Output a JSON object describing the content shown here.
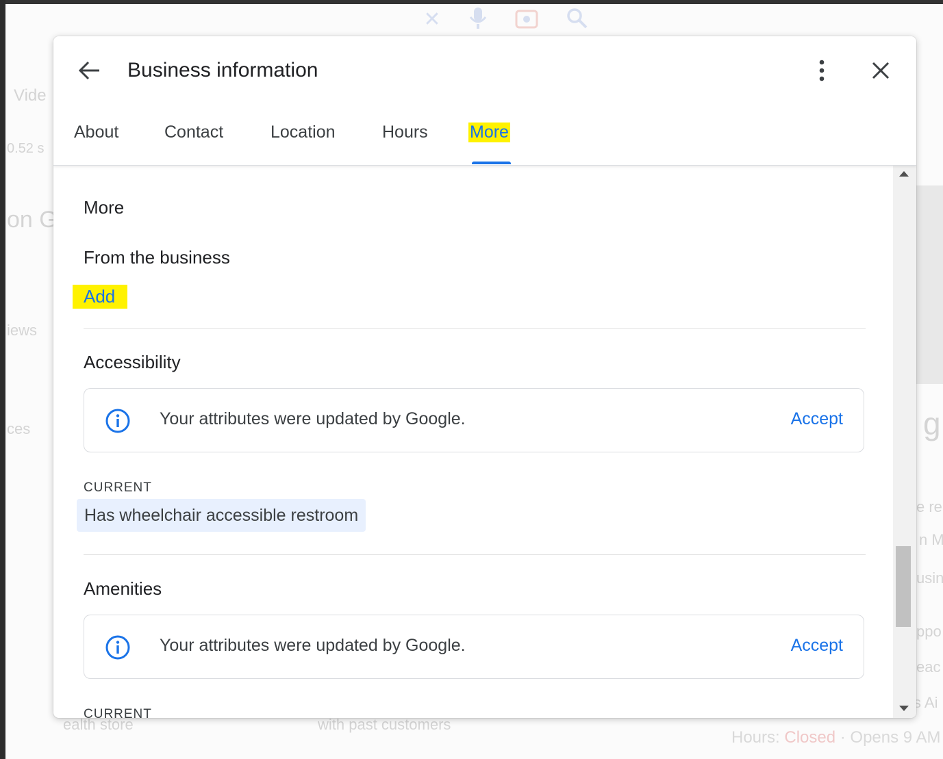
{
  "background": {
    "fragments": [
      "Vide",
      "0.52 s",
      "on G",
      "iews",
      "ces",
      "g",
      "e re",
      "n M",
      "usin",
      "ppo",
      "eac",
      "s Ai",
      "ealth store",
      "with past customers"
    ],
    "hours_label": "Hours:",
    "hours_status": "Closed",
    "hours_next": "· Opens 9 AM"
  },
  "dialog": {
    "title": "Business information",
    "tabs": [
      {
        "label": "About"
      },
      {
        "label": "Contact"
      },
      {
        "label": "Location"
      },
      {
        "label": "Hours"
      },
      {
        "label": "More"
      }
    ],
    "active_tab": "More",
    "content": {
      "heading": "More",
      "from_business": {
        "title": "From the business",
        "add_label": "Add"
      },
      "accessibility": {
        "title": "Accessibility",
        "notice": "Your attributes were updated by Google.",
        "accept_label": "Accept",
        "current_label": "CURRENT",
        "current_value": "Has wheelchair accessible restroom"
      },
      "amenities": {
        "title": "Amenities",
        "notice": "Your attributes were updated by Google.",
        "accept_label": "Accept",
        "current_label": "CURRENT"
      }
    }
  },
  "colors": {
    "accent": "#1a73e8",
    "highlight": "#fff200",
    "chip_background": "#e8f0fe",
    "text_primary": "#202124"
  },
  "icons": [
    "back-arrow-icon",
    "more-vert-icon",
    "close-icon",
    "info-icon",
    "scroll-up-arrow-icon",
    "scroll-down-arrow-icon"
  ]
}
